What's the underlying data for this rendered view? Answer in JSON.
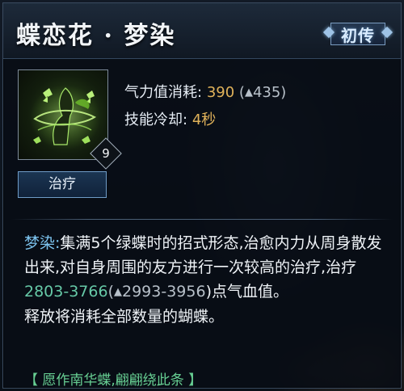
{
  "skill": {
    "title": "蝶恋花 · 梦染",
    "badge": "初传",
    "level": "9",
    "tag": "治疗"
  },
  "stats": {
    "cost_label": "气力值消耗:",
    "cost_value": "390",
    "cost_open": "(",
    "cost_upgraded": "435",
    "cost_close": ")",
    "cooldown_label": "技能冷却:",
    "cooldown_value": "4秒"
  },
  "description": {
    "prefix": "梦染:",
    "text1": "集满5个绿蝶时的招式形态,治愈内力从周身散发出来,对自身周围的友方进行一次较高的治疗,治疗",
    "heal_range": "2803-3766",
    "open": "(",
    "heal_upgraded": "2993-3956",
    "text2": ")点气血值。",
    "line2": "释放将消耗全部数量的蝴蝶。",
    "flavor": "【 愿作南华蝶,翩翩绕此条 】"
  },
  "icons": {
    "upgrade": "up-arrow-icon",
    "skill": "butterfly-skill-icon"
  },
  "colors": {
    "cost": "#e0b25a",
    "highlight_blue": "#7cc3ee",
    "heal_value": "#66c9a7",
    "flavor": "#67cf93"
  }
}
